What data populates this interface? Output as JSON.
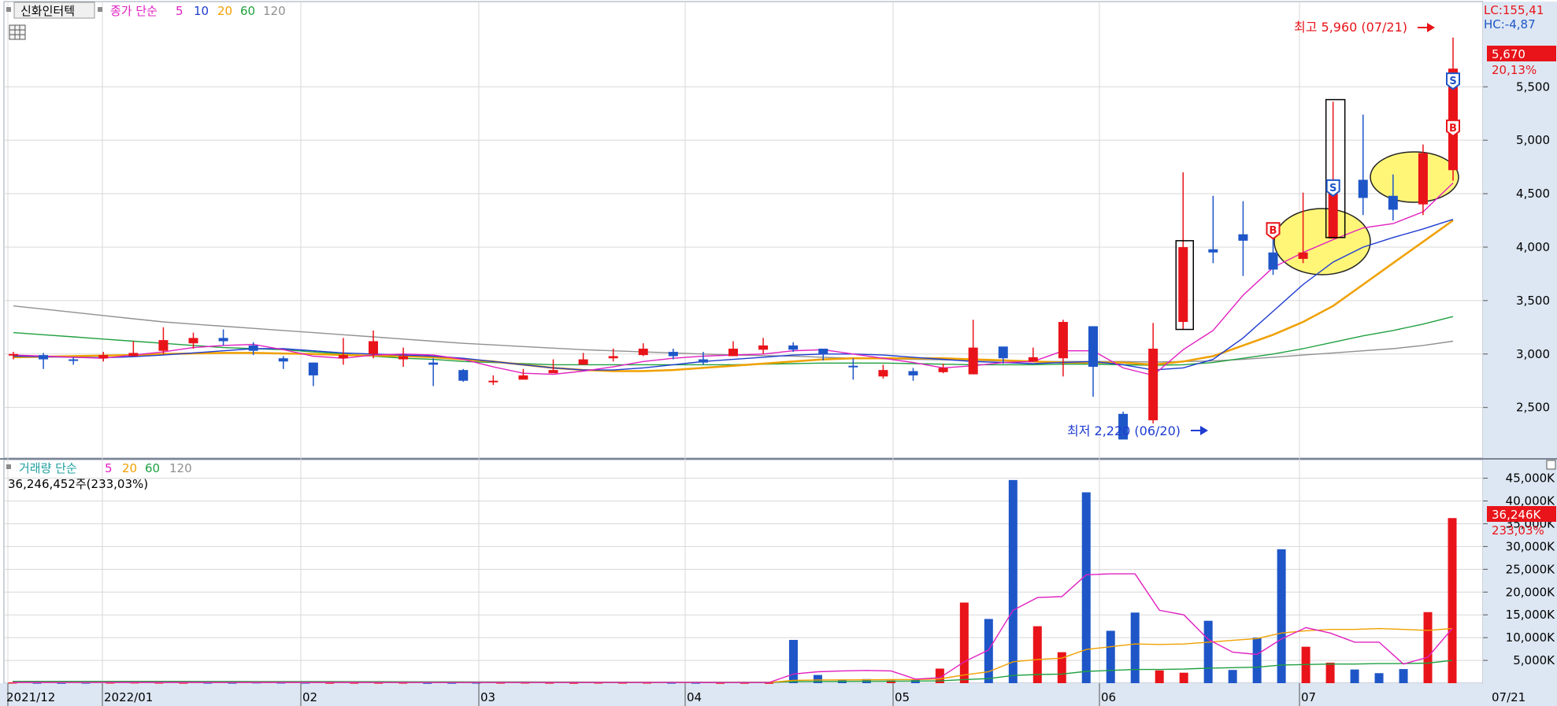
{
  "header": {
    "stock_name": "신화인터텍",
    "price_legend": {
      "label": "종가 단순",
      "periods": [
        "5",
        "10",
        "20",
        "60",
        "120"
      ]
    },
    "volume_legend": {
      "label": "거래량 단순",
      "periods": [
        "5",
        "20",
        "60",
        "120"
      ]
    },
    "lc": "LC:155,41",
    "hc": "HC:-4,87"
  },
  "price_panel": {
    "last_price": "5,670",
    "last_change": "20,13%",
    "high_note": "최고 5,960 (07/21)",
    "low_note": "최저 2,220 (06/20)",
    "axis_ticks": [
      "5,500",
      "5,000",
      "4,500",
      "4,000",
      "3,500",
      "3,000",
      "2,500"
    ],
    "signal_marks": [
      "S",
      "B",
      "S",
      "B"
    ]
  },
  "volume_panel": {
    "current_volume_text": "36,246,452주(233,03%)",
    "last_volume": "36,246K",
    "last_volume_change": "233,03%",
    "axis_ticks": [
      "45,000K",
      "40,000K",
      "35,000K",
      "30,000K",
      "25,000K",
      "20,000K",
      "15,000K",
      "10,000K",
      "5,000K"
    ]
  },
  "x_axis": {
    "labels": [
      "2021/12",
      "2022/01",
      "02",
      "03",
      "04",
      "05",
      "06",
      "07"
    ],
    "end_label": "07/21"
  },
  "colors": {
    "up": "#e8141a",
    "down": "#1e56c8",
    "ma5": "#e020c0",
    "ma10": "#1e3cd0",
    "ma20": "#f0a000",
    "ma60": "#20a040",
    "ma120": "#909090",
    "axis_bg": "#dde7f3",
    "grid": "#d8d8d8",
    "highlight": "#fff678"
  },
  "chart_data": [
    {
      "type": "candlestick",
      "title": "신화인터텍",
      "x": [
        "2021/12",
        "2022/01",
        "02",
        "03",
        "04",
        "05",
        "06",
        "07",
        "07/21"
      ],
      "ylim": [
        2100,
        6150
      ],
      "y_ticks": [
        2500,
        3000,
        3500,
        4000,
        4500,
        5000,
        5500
      ],
      "series": [
        {
          "name": "close",
          "values": [
            3000,
            2950,
            2940,
            2990,
            3010,
            3130,
            3150,
            3120,
            3030,
            2930,
            2800,
            2990,
            3120,
            2980,
            2900,
            2750,
            2750,
            2800,
            2850,
            2950,
            2980,
            3050,
            2980,
            2920,
            3050,
            3080,
            3040,
            3000,
            2880,
            2850,
            2800,
            2870,
            3060,
            2960,
            2970,
            3300,
            2880,
            2200,
            3050,
            4000,
            3950,
            4060,
            3790,
            3950,
            4600,
            4460,
            4350,
            4880,
            5670
          ]
        },
        {
          "name": "high",
          "values": [
            3020,
            3010,
            2970,
            3020,
            3120,
            3250,
            3200,
            3230,
            3110,
            2980,
            2920,
            3150,
            3220,
            3060,
            2960,
            2860,
            2800,
            2860,
            2950,
            3010,
            3050,
            3100,
            3050,
            3020,
            3120,
            3150,
            3110,
            3050,
            2960,
            2900,
            2870,
            2910,
            3320,
            3030,
            3060,
            3320,
            2950,
            2460,
            3290,
            4700,
            4480,
            4430,
            4200,
            4510,
            5360,
            5240,
            4680,
            4960,
            5960
          ]
        },
        {
          "name": "low",
          "values": [
            2950,
            2860,
            2900,
            2930,
            2980,
            3000,
            3050,
            3080,
            2990,
            2860,
            2700,
            2900,
            2960,
            2880,
            2700,
            2740,
            2710,
            2780,
            2830,
            2900,
            2930,
            2980,
            2950,
            2900,
            2980,
            3000,
            3020,
            2940,
            2760,
            2770,
            2750,
            2820,
            2810,
            2910,
            2940,
            2790,
            2600,
            2220,
            2350,
            3230,
            3850,
            3730,
            3740,
            3850,
            4090,
            4300,
            4250,
            4300,
            4620
          ]
        },
        {
          "name": "open",
          "values": [
            2990,
            2990,
            2950,
            2960,
            2980,
            3030,
            3100,
            3150,
            3080,
            2960,
            2920,
            2960,
            3000,
            2950,
            2920,
            2850,
            2740,
            2760,
            2820,
            2900,
            2960,
            2990,
            3020,
            2950,
            2980,
            3040,
            3080,
            3050,
            2890,
            2790,
            2840,
            2830,
            2810,
            3070,
            2930,
            2960,
            3260,
            2440,
            2380,
            3300,
            3980,
            4120,
            3950,
            3890,
            4080,
            4630,
            4480,
            4400,
            4720
          ]
        },
        {
          "name": "MA5",
          "values": [
            2990,
            2980,
            2970,
            2960,
            2990,
            3020,
            3060,
            3080,
            3090,
            3040,
            2980,
            2960,
            2990,
            3000,
            2990,
            2950,
            2880,
            2820,
            2810,
            2840,
            2880,
            2930,
            2960,
            2980,
            2990,
            3000,
            3030,
            3040,
            3000,
            2960,
            2920,
            2870,
            2890,
            2920,
            2930,
            3030,
            3030,
            2870,
            2800,
            3040,
            3220,
            3550,
            3810,
            3950,
            4070,
            4180,
            4220,
            4330,
            4600
          ]
        },
        {
          "name": "MA10",
          "values": [
            2980,
            2975,
            2970,
            2965,
            2975,
            2990,
            3010,
            3030,
            3050,
            3050,
            3030,
            3010,
            3000,
            2990,
            2980,
            2960,
            2930,
            2900,
            2870,
            2850,
            2850,
            2870,
            2900,
            2930,
            2950,
            2970,
            2990,
            3000,
            3000,
            2990,
            2970,
            2950,
            2930,
            2920,
            2910,
            2920,
            2930,
            2900,
            2850,
            2870,
            2950,
            3150,
            3400,
            3650,
            3860,
            4000,
            4090,
            4170,
            4260
          ]
        },
        {
          "name": "MA20",
          "values": [
            2970,
            2975,
            2980,
            2985,
            2990,
            3000,
            3005,
            3010,
            3010,
            3005,
            3000,
            2990,
            2985,
            2980,
            2970,
            2950,
            2930,
            2900,
            2870,
            2850,
            2840,
            2840,
            2850,
            2870,
            2890,
            2910,
            2930,
            2950,
            2960,
            2960,
            2960,
            2960,
            2950,
            2940,
            2930,
            2920,
            2920,
            2920,
            2900,
            2930,
            2980,
            3080,
            3180,
            3300,
            3450,
            3650,
            3850,
            4050,
            4250
          ]
        },
        {
          "name": "MA60",
          "values": [
            3200,
            3180,
            3160,
            3140,
            3120,
            3100,
            3080,
            3060,
            3050,
            3040,
            3020,
            3000,
            2980,
            2960,
            2950,
            2930,
            2920,
            2910,
            2900,
            2900,
            2900,
            2900,
            2900,
            2900,
            2900,
            2905,
            2910,
            2915,
            2915,
            2915,
            2910,
            2905,
            2900,
            2900,
            2900,
            2905,
            2905,
            2900,
            2895,
            2900,
            2920,
            2960,
            3000,
            3050,
            3110,
            3170,
            3220,
            3280,
            3350
          ]
        },
        {
          "name": "MA120",
          "values": [
            3450,
            3420,
            3390,
            3360,
            3330,
            3300,
            3280,
            3260,
            3240,
            3220,
            3200,
            3180,
            3160,
            3140,
            3120,
            3100,
            3085,
            3070,
            3055,
            3040,
            3030,
            3020,
            3010,
            3000,
            2990,
            2985,
            2980,
            2970,
            2960,
            2955,
            2950,
            2945,
            2940,
            2935,
            2930,
            2930,
            2930,
            2930,
            2925,
            2930,
            2935,
            2950,
            2970,
            2990,
            3010,
            3030,
            3050,
            3080,
            3120
          ]
        }
      ]
    },
    {
      "type": "bar",
      "title": "거래량",
      "x": [
        "2021/12",
        "2022/01",
        "02",
        "03",
        "04",
        "05",
        "06",
        "07",
        "07/21"
      ],
      "ylim": [
        0,
        47000
      ],
      "y_ticks": [
        5000,
        10000,
        15000,
        20000,
        25000,
        30000,
        35000,
        40000,
        45000
      ],
      "y_unit": "K",
      "series": [
        {
          "name": "volume",
          "values": [
            180,
            150,
            130,
            160,
            170,
            200,
            170,
            150,
            160,
            150,
            210,
            180,
            170,
            140,
            150,
            150,
            160,
            120,
            140,
            170,
            160,
            180,
            150,
            130,
            170,
            160,
            170,
            150,
            150,
            130,
            140,
            120,
            9500,
            1800,
            600,
            900,
            600,
            800,
            3200,
            17700,
            14100,
            44600,
            12500,
            6800,
            41900,
            11500,
            15500,
            2800,
            2300,
            13700,
            2900,
            10000,
            29400,
            8000,
            4500,
            3000,
            2200,
            3100,
            15600,
            36246
          ]
        },
        {
          "name": "MA5",
          "values": [
            170,
            165,
            160,
            160,
            165,
            175,
            175,
            170,
            165,
            160,
            170,
            175,
            175,
            170,
            165,
            160,
            155,
            150,
            145,
            150,
            155,
            160,
            160,
            155,
            160,
            160,
            160,
            155,
            150,
            145,
            140,
            140,
            2000,
            2500,
            2700,
            2800,
            2700,
            900,
            1200,
            4700,
            7300,
            16000,
            18800,
            19000,
            23800,
            24000,
            24000,
            16000,
            15000,
            9600,
            6800,
            6300,
            9700,
            12200,
            11000,
            9000,
            9000,
            4200,
            5700,
            12000
          ]
        },
        {
          "name": "MA20",
          "values": [
            160,
            160,
            160,
            160,
            160,
            160,
            160,
            160,
            160,
            160,
            165,
            165,
            165,
            165,
            165,
            160,
            160,
            160,
            160,
            160,
            160,
            160,
            160,
            160,
            160,
            160,
            160,
            160,
            160,
            160,
            160,
            160,
            600,
            700,
            720,
            750,
            780,
            800,
            950,
            1800,
            2500,
            4700,
            5200,
            5500,
            7400,
            8000,
            8600,
            8500,
            8600,
            9000,
            9400,
            9800,
            11000,
            11500,
            11800,
            11800,
            12000,
            11800,
            11600,
            12000
          ]
        },
        {
          "name": "MA60",
          "values": [
            400,
            400,
            400,
            400,
            400,
            400,
            390,
            390,
            380,
            380,
            370,
            360,
            350,
            340,
            330,
            320,
            310,
            300,
            290,
            280,
            270,
            260,
            250,
            240,
            230,
            220,
            210,
            200,
            200,
            200,
            200,
            200,
            350,
            380,
            400,
            420,
            440,
            460,
            500,
            800,
            1000,
            1700,
            1900,
            2000,
            2600,
            2800,
            3000,
            3000,
            3100,
            3300,
            3400,
            3500,
            4000,
            4100,
            4200,
            4200,
            4300,
            4300,
            4400,
            5000
          ]
        }
      ]
    }
  ]
}
